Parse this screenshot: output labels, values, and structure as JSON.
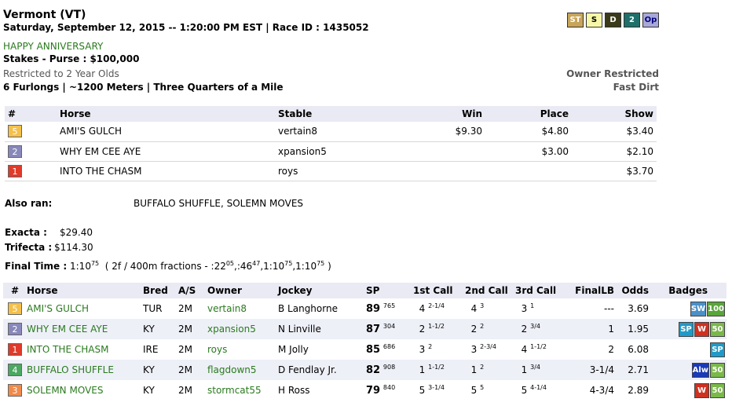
{
  "header": {
    "title": "Vermont (VT)",
    "subtitle": "Saturday, September 12, 2015 -- 1:20:00 PM EST | Race ID : 1435052",
    "race_name": "HAPPY ANNIVERSARY",
    "purse": "Stakes - Purse : $100,000",
    "restriction": "Restricted to 2 Year Olds",
    "distance": "6 Furlongs | ~1200 Meters | Three Quarters of a Mile",
    "owner_restricted": "Owner Restricted",
    "surface": "Fast Dirt",
    "icons": [
      {
        "label": "ST",
        "name": "st-icon",
        "bg": "#c8a55a",
        "fg": "#ffffff"
      },
      {
        "label": "S",
        "name": "s-icon",
        "bg": "#f7f7a8",
        "fg": "#000000"
      },
      {
        "label": "D",
        "name": "d-icon",
        "bg": "#3a3a1a",
        "fg": "#ffffff"
      },
      {
        "label": "2",
        "name": "two-icon",
        "bg": "#1f6f6a",
        "fg": "#ffffff"
      },
      {
        "label": "Op",
        "name": "op-icon",
        "bg": "#a8a8d8",
        "fg": "#000080"
      }
    ]
  },
  "results": {
    "headers": [
      "#",
      "Horse",
      "Stable",
      "Win",
      "Place",
      "Show"
    ],
    "rows": [
      {
        "pp": "5",
        "pp_bg": "#f5c04a",
        "horse": "AMI'S GULCH",
        "stable": "vertain8",
        "win": "$9.30",
        "place": "$4.80",
        "show": "$3.40"
      },
      {
        "pp": "2",
        "pp_bg": "#8888bb",
        "horse": "WHY EM CEE AYE",
        "stable": "xpansion5",
        "win": "",
        "place": "$3.00",
        "show": "$2.10"
      },
      {
        "pp": "1",
        "pp_bg": "#e03a2a",
        "horse": "INTO THE CHASM",
        "stable": "roys",
        "win": "",
        "place": "",
        "show": "$3.70"
      }
    ]
  },
  "also_ran": {
    "label": "Also ran:",
    "value": "BUFFALO SHUFFLE, SOLEMN MOVES"
  },
  "exacta": {
    "label": "Exacta :",
    "value": "$29.40"
  },
  "trifecta": {
    "label": "Trifecta :",
    "value": "$114.30"
  },
  "final_time": {
    "label": "Final Time :",
    "time": "1:10",
    "time_sup": "75",
    "fractions_prefix": "( 2f / 400m fractions - :22",
    "f1_sup": "05",
    "f2": ",:46",
    "f2_sup": "47",
    "f3": ",1:10",
    "f3_sup": "75",
    "f4": ",1:10",
    "f4_sup": "75",
    "close": ")"
  },
  "chart": {
    "headers": [
      "#",
      "Horse",
      "Bred",
      "A/S",
      "Owner",
      "Jockey",
      "SP",
      "1st Call",
      "2nd Call",
      "3rd Call",
      "FinalLB",
      "Odds",
      "Badges"
    ],
    "rows": [
      {
        "pp": "5",
        "pp_bg": "#f5c04a",
        "horse": "AMI'S GULCH",
        "bred": "TUR",
        "as": "2M",
        "owner": "vertain8",
        "jockey": "B Langhorne",
        "sp": "89",
        "sp_sup": "765",
        "c1": "4",
        "c1s": "2-1/4",
        "c2": "4",
        "c2s": "3",
        "c3": "3",
        "c3s": "1",
        "final": "---",
        "odds": "3.69",
        "badges": [
          {
            "t": "SW",
            "bg": "#4a90c8",
            "name": "sw-badge"
          },
          {
            "t": "100",
            "bg": "#5aa53a",
            "name": "100-badge"
          }
        ]
      },
      {
        "pp": "2",
        "pp_bg": "#8888bb",
        "horse": "WHY EM CEE AYE",
        "bred": "KY",
        "as": "2M",
        "owner": "xpansion5",
        "jockey": "N Linville",
        "sp": "87",
        "sp_sup": "304",
        "c1": "2",
        "c1s": "1-1/2",
        "c2": "2",
        "c2s": "2",
        "c3": "2",
        "c3s": "3/4",
        "final": "1",
        "odds": "1.95",
        "badges": [
          {
            "t": "SP",
            "bg": "#1f9ac8",
            "name": "sp-badge"
          },
          {
            "t": "W",
            "bg": "#d03020",
            "name": "w-badge"
          },
          {
            "t": "50",
            "bg": "#7ab84a",
            "name": "50-badge"
          }
        ]
      },
      {
        "pp": "1",
        "pp_bg": "#e03a2a",
        "horse": "INTO THE CHASM",
        "bred": "IRE",
        "as": "2M",
        "owner": "roys",
        "jockey": "M Jolly",
        "sp": "85",
        "sp_sup": "686",
        "c1": "3",
        "c1s": "2",
        "c2": "3",
        "c2s": "2-3/4",
        "c3": "4",
        "c3s": "1-1/2",
        "final": "2",
        "odds": "6.08",
        "badges": [
          {
            "t": "SP",
            "bg": "#1f9ac8",
            "name": "sp-badge"
          }
        ]
      },
      {
        "pp": "4",
        "pp_bg": "#4aa860",
        "horse": "BUFFALO SHUFFLE",
        "bred": "KY",
        "as": "2M",
        "owner": "flagdown5",
        "jockey": "D Fendlay Jr.",
        "sp": "82",
        "sp_sup": "908",
        "c1": "1",
        "c1s": "1-1/2",
        "c2": "1",
        "c2s": "2",
        "c3": "1",
        "c3s": "3/4",
        "final": "3-1/4",
        "odds": "2.71",
        "badges": [
          {
            "t": "Alw",
            "bg": "#1a3ab8",
            "name": "alw-badge"
          },
          {
            "t": "50",
            "bg": "#7ab84a",
            "name": "50-badge"
          }
        ]
      },
      {
        "pp": "3",
        "pp_bg": "#f08a4a",
        "horse": "SOLEMN MOVES",
        "bred": "KY",
        "as": "2M",
        "owner": "stormcat55",
        "jockey": "H Ross",
        "sp": "79",
        "sp_sup": "840",
        "c1": "5",
        "c1s": "3-1/4",
        "c2": "5",
        "c2s": "5",
        "c3": "5",
        "c3s": "4-1/4",
        "final": "4-3/4",
        "odds": "2.89",
        "badges": [
          {
            "t": "W",
            "bg": "#d03020",
            "name": "w-badge"
          },
          {
            "t": "50",
            "bg": "#7ab84a",
            "name": "50-badge"
          }
        ]
      }
    ]
  }
}
